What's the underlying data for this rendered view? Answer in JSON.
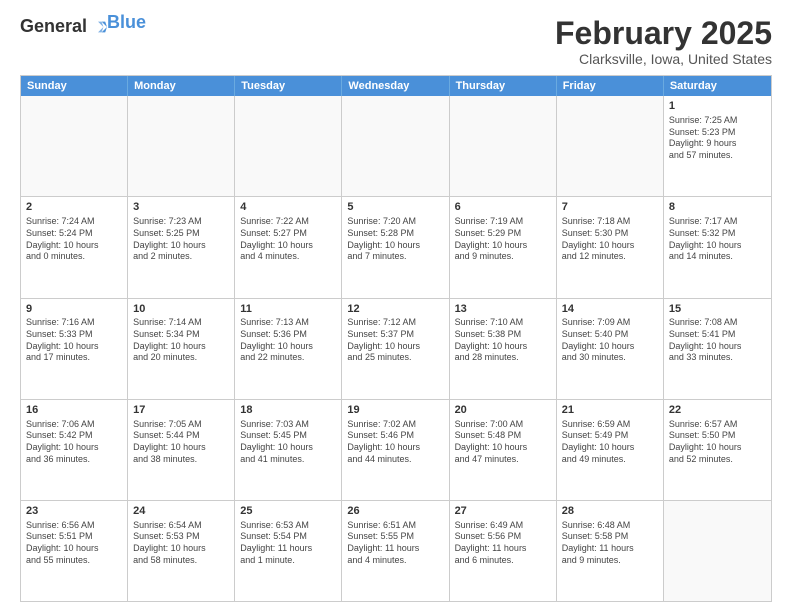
{
  "logo": {
    "general": "General",
    "blue": "Blue"
  },
  "title": "February 2025",
  "subtitle": "Clarksville, Iowa, United States",
  "header_days": [
    "Sunday",
    "Monday",
    "Tuesday",
    "Wednesday",
    "Thursday",
    "Friday",
    "Saturday"
  ],
  "rows": [
    [
      {
        "day": "",
        "info": ""
      },
      {
        "day": "",
        "info": ""
      },
      {
        "day": "",
        "info": ""
      },
      {
        "day": "",
        "info": ""
      },
      {
        "day": "",
        "info": ""
      },
      {
        "day": "",
        "info": ""
      },
      {
        "day": "1",
        "info": "Sunrise: 7:25 AM\nSunset: 5:23 PM\nDaylight: 9 hours\nand 57 minutes."
      }
    ],
    [
      {
        "day": "2",
        "info": "Sunrise: 7:24 AM\nSunset: 5:24 PM\nDaylight: 10 hours\nand 0 minutes."
      },
      {
        "day": "3",
        "info": "Sunrise: 7:23 AM\nSunset: 5:25 PM\nDaylight: 10 hours\nand 2 minutes."
      },
      {
        "day": "4",
        "info": "Sunrise: 7:22 AM\nSunset: 5:27 PM\nDaylight: 10 hours\nand 4 minutes."
      },
      {
        "day": "5",
        "info": "Sunrise: 7:20 AM\nSunset: 5:28 PM\nDaylight: 10 hours\nand 7 minutes."
      },
      {
        "day": "6",
        "info": "Sunrise: 7:19 AM\nSunset: 5:29 PM\nDaylight: 10 hours\nand 9 minutes."
      },
      {
        "day": "7",
        "info": "Sunrise: 7:18 AM\nSunset: 5:30 PM\nDaylight: 10 hours\nand 12 minutes."
      },
      {
        "day": "8",
        "info": "Sunrise: 7:17 AM\nSunset: 5:32 PM\nDaylight: 10 hours\nand 14 minutes."
      }
    ],
    [
      {
        "day": "9",
        "info": "Sunrise: 7:16 AM\nSunset: 5:33 PM\nDaylight: 10 hours\nand 17 minutes."
      },
      {
        "day": "10",
        "info": "Sunrise: 7:14 AM\nSunset: 5:34 PM\nDaylight: 10 hours\nand 20 minutes."
      },
      {
        "day": "11",
        "info": "Sunrise: 7:13 AM\nSunset: 5:36 PM\nDaylight: 10 hours\nand 22 minutes."
      },
      {
        "day": "12",
        "info": "Sunrise: 7:12 AM\nSunset: 5:37 PM\nDaylight: 10 hours\nand 25 minutes."
      },
      {
        "day": "13",
        "info": "Sunrise: 7:10 AM\nSunset: 5:38 PM\nDaylight: 10 hours\nand 28 minutes."
      },
      {
        "day": "14",
        "info": "Sunrise: 7:09 AM\nSunset: 5:40 PM\nDaylight: 10 hours\nand 30 minutes."
      },
      {
        "day": "15",
        "info": "Sunrise: 7:08 AM\nSunset: 5:41 PM\nDaylight: 10 hours\nand 33 minutes."
      }
    ],
    [
      {
        "day": "16",
        "info": "Sunrise: 7:06 AM\nSunset: 5:42 PM\nDaylight: 10 hours\nand 36 minutes."
      },
      {
        "day": "17",
        "info": "Sunrise: 7:05 AM\nSunset: 5:44 PM\nDaylight: 10 hours\nand 38 minutes."
      },
      {
        "day": "18",
        "info": "Sunrise: 7:03 AM\nSunset: 5:45 PM\nDaylight: 10 hours\nand 41 minutes."
      },
      {
        "day": "19",
        "info": "Sunrise: 7:02 AM\nSunset: 5:46 PM\nDaylight: 10 hours\nand 44 minutes."
      },
      {
        "day": "20",
        "info": "Sunrise: 7:00 AM\nSunset: 5:48 PM\nDaylight: 10 hours\nand 47 minutes."
      },
      {
        "day": "21",
        "info": "Sunrise: 6:59 AM\nSunset: 5:49 PM\nDaylight: 10 hours\nand 49 minutes."
      },
      {
        "day": "22",
        "info": "Sunrise: 6:57 AM\nSunset: 5:50 PM\nDaylight: 10 hours\nand 52 minutes."
      }
    ],
    [
      {
        "day": "23",
        "info": "Sunrise: 6:56 AM\nSunset: 5:51 PM\nDaylight: 10 hours\nand 55 minutes."
      },
      {
        "day": "24",
        "info": "Sunrise: 6:54 AM\nSunset: 5:53 PM\nDaylight: 10 hours\nand 58 minutes."
      },
      {
        "day": "25",
        "info": "Sunrise: 6:53 AM\nSunset: 5:54 PM\nDaylight: 11 hours\nand 1 minute."
      },
      {
        "day": "26",
        "info": "Sunrise: 6:51 AM\nSunset: 5:55 PM\nDaylight: 11 hours\nand 4 minutes."
      },
      {
        "day": "27",
        "info": "Sunrise: 6:49 AM\nSunset: 5:56 PM\nDaylight: 11 hours\nand 6 minutes."
      },
      {
        "day": "28",
        "info": "Sunrise: 6:48 AM\nSunset: 5:58 PM\nDaylight: 11 hours\nand 9 minutes."
      },
      {
        "day": "",
        "info": ""
      }
    ]
  ]
}
